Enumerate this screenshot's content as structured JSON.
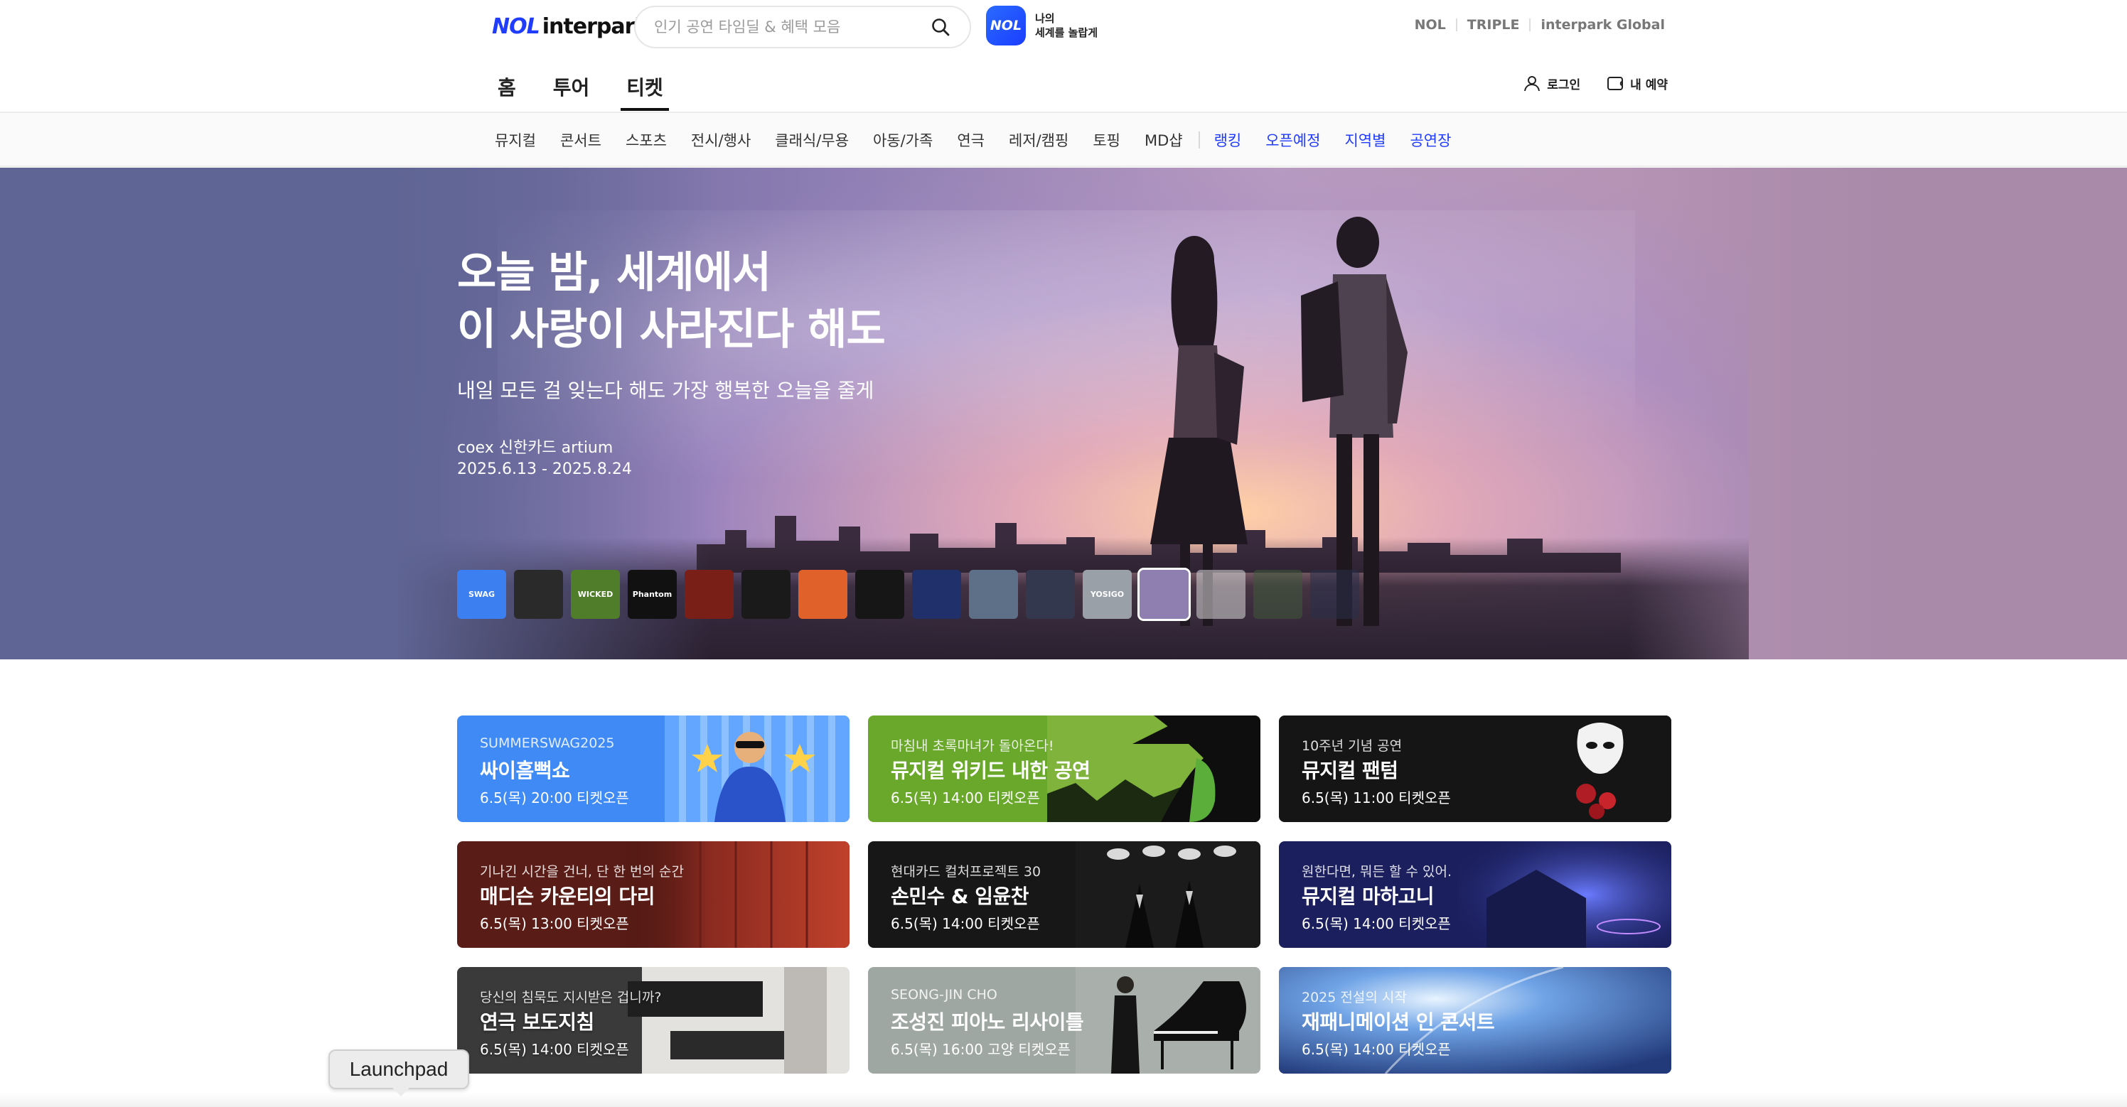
{
  "header": {
    "logo_nol": "NOL",
    "logo_interpark": "interpark",
    "search_placeholder": "인기 공연 타임딜 & 혜택 모음",
    "nol_badge": "NOL",
    "nol_copy_1": "나의",
    "nol_copy_2": "세계를 놀랍게",
    "global_links": [
      "NOL",
      "TRIPLE",
      "interpark Global"
    ]
  },
  "main_nav": {
    "tabs": [
      {
        "label": "홈",
        "active": false
      },
      {
        "label": "투어",
        "active": false
      },
      {
        "label": "티켓",
        "active": true
      }
    ],
    "login": "로그인",
    "my_reservation": "내 예약"
  },
  "category_nav": {
    "items": [
      "뮤지컬",
      "콘서트",
      "스포츠",
      "전시/행사",
      "클래식/무용",
      "아동/가족",
      "연극",
      "레저/캠핑",
      "토핑",
      "MD샵"
    ],
    "blue_items": [
      "랭킹",
      "오픈예정",
      "지역별",
      "공연장"
    ]
  },
  "hero": {
    "title_line1": "오늘 밤, 세계에서",
    "title_line2": "이 사랑이 사라진다 해도",
    "subtitle": "내일 모든 걸 잊는다 해도 가장 행복한 오늘을 줄게",
    "venue": "coex 신한카드 artium",
    "dates": "2025.6.13 - 2025.8.24",
    "thumbnails": [
      {
        "name": "summer-swag",
        "color": "#3b7ff0",
        "text": "SWAG"
      },
      {
        "name": "musical-bw",
        "color": "#2a2a2a",
        "text": ""
      },
      {
        "name": "wicked",
        "color": "#4f7d2a",
        "text": "WICKED"
      },
      {
        "name": "phantom",
        "color": "#111111",
        "text": "Phantom"
      },
      {
        "name": "red-poster",
        "color": "#7a1e18",
        "text": ""
      },
      {
        "name": "dark-hands",
        "color": "#1a1a1a",
        "text": ""
      },
      {
        "name": "orange-poster",
        "color": "#e0622a",
        "text": ""
      },
      {
        "name": "dark-crowd",
        "color": "#161616",
        "text": ""
      },
      {
        "name": "blue-stage",
        "color": "#20306a",
        "text": ""
      },
      {
        "name": "men-photo",
        "color": "#5e6f88",
        "text": ""
      },
      {
        "name": "band-photo",
        "color": "#33384f",
        "text": ""
      },
      {
        "name": "yosigo",
        "color": "#9aa0a8",
        "text": "YOSIGO"
      },
      {
        "name": "couple-sunset",
        "color": "#8e7fb0",
        "text": ""
      },
      {
        "name": "white-poster",
        "color": "#d8d8d8",
        "text": ""
      },
      {
        "name": "green-forest",
        "color": "#3f5a3a",
        "text": ""
      },
      {
        "name": "palace-night",
        "color": "#2a2f4a",
        "text": ""
      }
    ]
  },
  "cards": [
    {
      "kick": "SUMMERSWAG2025",
      "title": "싸이흠뻑쇼",
      "when": "6.5(목) 20:00 티켓오픈"
    },
    {
      "kick": "마침내 초록마녀가 돌아온다!",
      "title": "뮤지컬 위키드 내한 공연",
      "when": "6.5(목) 14:00 티켓오픈"
    },
    {
      "kick": "10주년 기념 공연",
      "title": "뮤지컬 팬텀",
      "when": "6.5(목) 11:00 티켓오픈"
    },
    {
      "kick": "기나긴 시간을 건너, 단 한 번의 순간",
      "title": "매디슨 카운티의 다리",
      "when": "6.5(목) 13:00 티켓오픈"
    },
    {
      "kick": "현대카드 컬처프로젝트 30",
      "title": "손민수 & 임윤찬",
      "when": "6.5(목) 14:00 티켓오픈"
    },
    {
      "kick": "원한다면, 뭐든 할 수 있어.",
      "title": "뮤지컬 마하고니",
      "when": "6.5(목) 14:00 티켓오픈"
    },
    {
      "kick": "당신의 침묵도 지시받은 겁니까?",
      "title": "연극 보도지침",
      "when": "6.5(목) 14:00 티켓오픈"
    },
    {
      "kick": "SEONG-JIN CHO",
      "title": "조성진 피아노 리사이틀",
      "when": "6.5(목) 16:00 고양 티켓오픈"
    },
    {
      "kick": "2025 전설의 시작",
      "title": "재패니메이션 인 콘서트",
      "when": "6.5(목) 14:00 티켓오픈"
    }
  ],
  "tooltip": {
    "label": "Launchpad"
  }
}
